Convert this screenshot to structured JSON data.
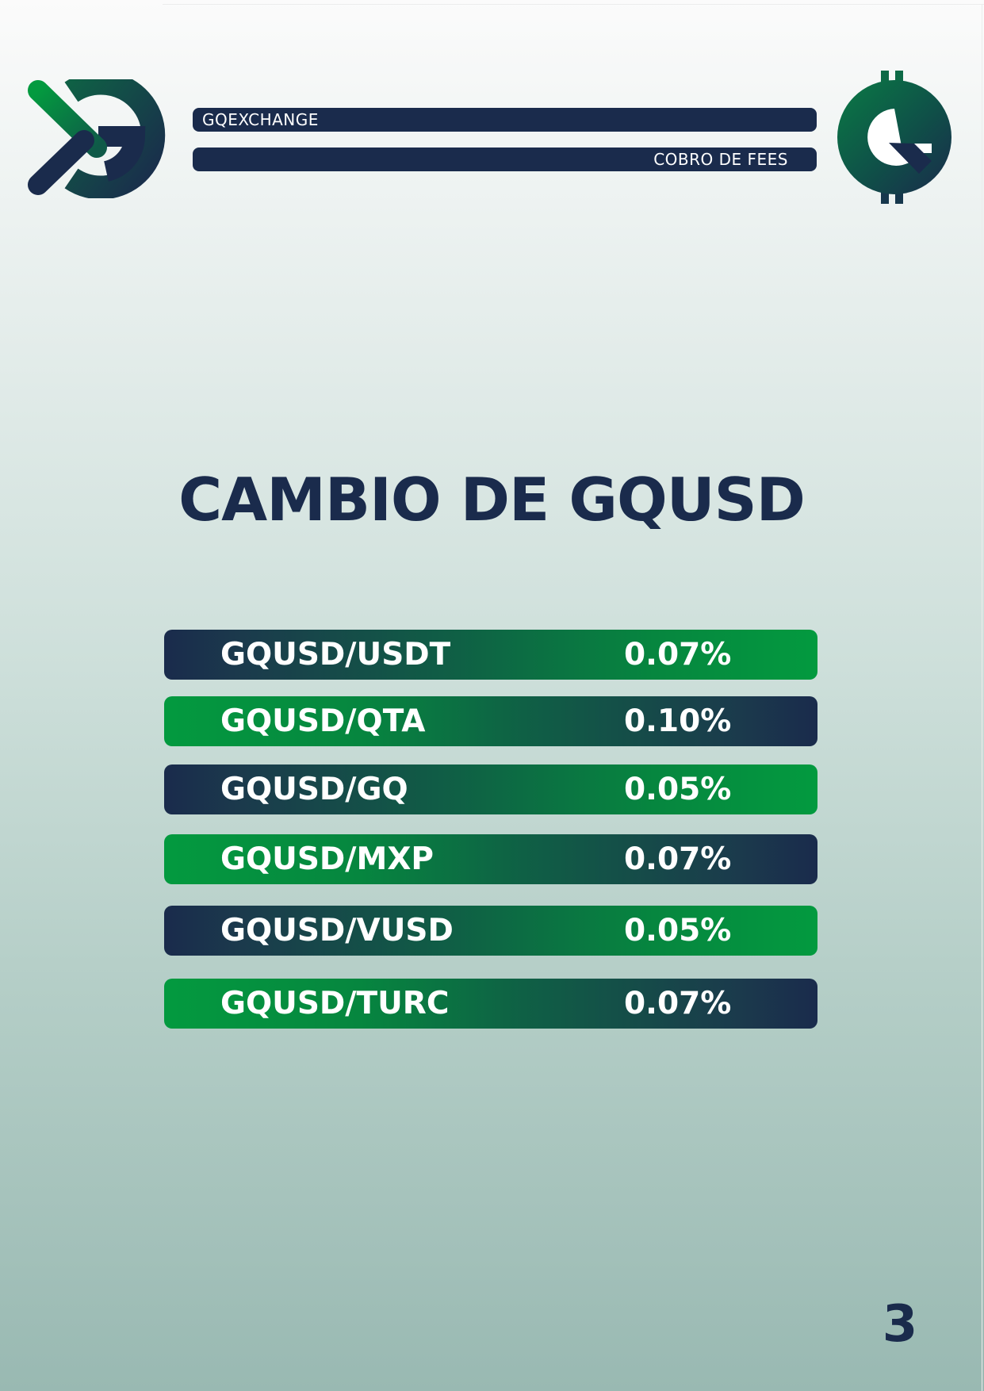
{
  "header": {
    "brand_label": "GQEXCHANGE",
    "subtitle": "COBRO DE FEES"
  },
  "logos": {
    "left_icon": "gq-exchange-logo-icon",
    "right_icon": "gq-coin-dollar-icon"
  },
  "title": "CAMBIO DE GQUSD",
  "fees": [
    {
      "pair": "GQUSD/USDT",
      "fee": "0.07%"
    },
    {
      "pair": "GQUSD/QTA",
      "fee": "0.10%"
    },
    {
      "pair": "GQUSD/GQ",
      "fee": "0.05%"
    },
    {
      "pair": "GQUSD/MXP",
      "fee": "0.07%"
    },
    {
      "pair": "GQUSD/VUSD",
      "fee": "0.05%"
    },
    {
      "pair": "GQUSD/TURC",
      "fee": "0.07%"
    }
  ],
  "page_number": "3",
  "colors": {
    "navy": "#1a2b4c",
    "green": "#039a3f",
    "deep_green": "#0a5a3c",
    "text_light": "#ffffff"
  }
}
